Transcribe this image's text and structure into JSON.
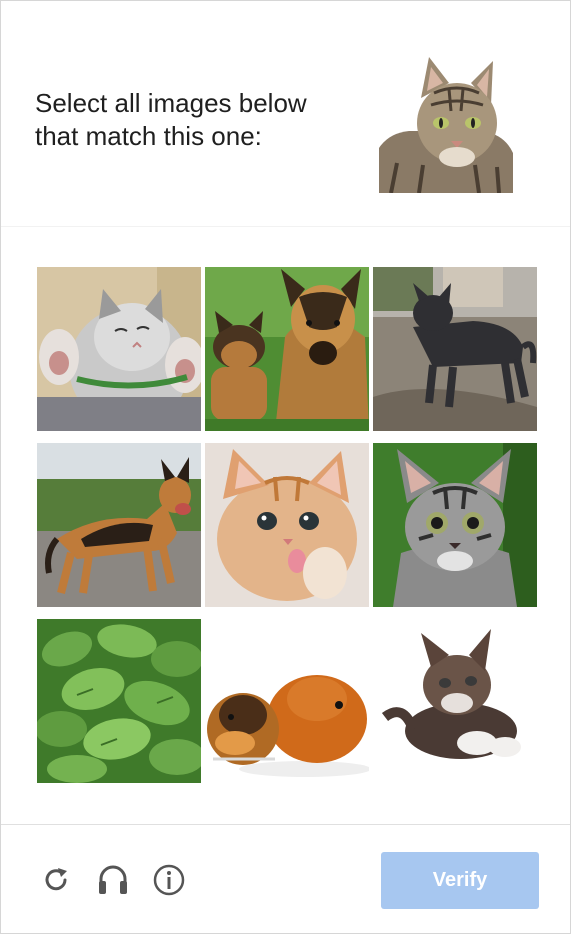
{
  "prompt": {
    "line1": "Select all images below",
    "line2": "that match this one:"
  },
  "sample_image": {
    "subject": "tabby cat"
  },
  "grid": {
    "tiles": [
      {
        "subject": "kitten with paws up",
        "icon": "kitten-icon"
      },
      {
        "subject": "german shepherd with puppy",
        "icon": "dog-icon"
      },
      {
        "subject": "dark dog on path",
        "icon": "dog-icon"
      },
      {
        "subject": "german shepherd on road",
        "icon": "dog-icon"
      },
      {
        "subject": "orange kitten",
        "icon": "kitten-icon"
      },
      {
        "subject": "tabby kitten",
        "icon": "kitten-icon"
      },
      {
        "subject": "green leaves plant",
        "icon": "plant-icon"
      },
      {
        "subject": "two guinea pigs",
        "icon": "guinea-pig-icon"
      },
      {
        "subject": "fluffy kitten",
        "icon": "kitten-icon"
      }
    ]
  },
  "footer": {
    "icons": [
      "reload-icon",
      "audio-icon",
      "info-icon"
    ],
    "verify_label": "Verify"
  },
  "colors": {
    "verify_bg": "#a7c7f0",
    "text": "#1f1f1f",
    "icon": "#555555"
  }
}
